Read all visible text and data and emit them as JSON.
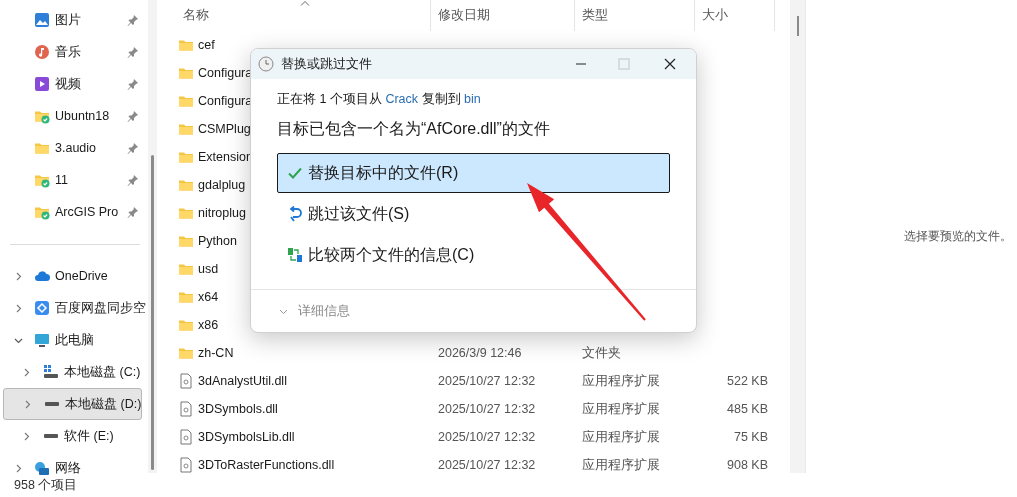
{
  "nav": {
    "quick_access": [
      {
        "label": "图片",
        "kind": "pictures",
        "pinned": true,
        "selected": false
      },
      {
        "label": "音乐",
        "kind": "music",
        "pinned": true,
        "selected": false
      },
      {
        "label": "视频",
        "kind": "videos",
        "pinned": true,
        "selected": false
      },
      {
        "label": "Ubuntn18",
        "kind": "synced-folder",
        "pinned": true,
        "selected": false
      },
      {
        "label": "3.audio",
        "kind": "folder",
        "pinned": true,
        "selected": false
      },
      {
        "label": "11",
        "kind": "synced-folder",
        "pinned": true,
        "selected": false
      },
      {
        "label": "ArcGIS Pro",
        "kind": "synced-folder",
        "pinned": true,
        "selected": false
      }
    ],
    "tree": [
      {
        "label": "OneDrive",
        "kind": "cloud",
        "expanded": false,
        "selected": false
      },
      {
        "label": "百度网盘同步空",
        "kind": "netdisk",
        "expanded": false,
        "selected": false
      },
      {
        "label": "此电脑",
        "kind": "computer",
        "expanded": true,
        "selected": false,
        "children": [
          {
            "label": "本地磁盘 (C:)",
            "kind": "system-drive",
            "expanded": false,
            "selected": false
          },
          {
            "label": "本地磁盘 (D:)",
            "kind": "drive",
            "expanded": false,
            "selected": true
          },
          {
            "label": "软件 (E:)",
            "kind": "drive",
            "expanded": false,
            "selected": false
          }
        ]
      },
      {
        "label": "网络",
        "kind": "network",
        "expanded": false,
        "selected": false
      }
    ]
  },
  "file_list": {
    "columns": [
      {
        "label": "名称",
        "sorted": true
      },
      {
        "label": "修改日期",
        "sorted": false
      },
      {
        "label": "类型",
        "sorted": false
      },
      {
        "label": "大小",
        "sorted": false
      }
    ],
    "rows": [
      {
        "kind": "folder",
        "name": "cef"
      },
      {
        "kind": "folder",
        "name": "Configura"
      },
      {
        "kind": "folder",
        "name": "Configura"
      },
      {
        "kind": "folder",
        "name": "CSMPlug"
      },
      {
        "kind": "folder",
        "name": "Extension"
      },
      {
        "kind": "folder",
        "name": "gdalplug"
      },
      {
        "kind": "folder",
        "name": "nitroplug"
      },
      {
        "kind": "folder",
        "name": "Python"
      },
      {
        "kind": "folder",
        "name": "usd"
      },
      {
        "kind": "folder",
        "name": "x64"
      },
      {
        "kind": "folder",
        "name": "x86"
      },
      {
        "kind": "folder",
        "name": "zh-CN",
        "date": "2026/3/9 12:46",
        "type": "文件夹"
      },
      {
        "kind": "file",
        "name": "3dAnalystUtil.dll",
        "date": "2025/10/27 12:32",
        "type": "应用程序扩展",
        "size": "522 KB"
      },
      {
        "kind": "file",
        "name": "3DSymbols.dll",
        "date": "2025/10/27 12:32",
        "type": "应用程序扩展",
        "size": "485 KB"
      },
      {
        "kind": "file",
        "name": "3DSymbolsLib.dll",
        "date": "2025/10/27 12:32",
        "type": "应用程序扩展",
        "size": "75 KB"
      },
      {
        "kind": "file",
        "name": "3DToRasterFunctions.dll",
        "date": "2025/10/27 12:32",
        "type": "应用程序扩展",
        "size": "908 KB"
      }
    ]
  },
  "preview": {
    "message": "选择要预览的文件。"
  },
  "status_bar": {
    "item_count": "958 个项目"
  },
  "dialog": {
    "title": "替换或跳过文件",
    "copy_status": {
      "prefix": "正在将 1 个项目从",
      "source": "Crack",
      "middle": "复制到",
      "destination": "bin"
    },
    "message": "目标已包含一个名为“AfCore.dll”的文件",
    "options": [
      {
        "kind": "replace",
        "label": "替换目标中的文件(R)",
        "selected": true
      },
      {
        "kind": "skip",
        "label": "跳过该文件(S)",
        "selected": false
      },
      {
        "kind": "compare",
        "label": "比较两个文件的信息(C)",
        "selected": false
      }
    ],
    "details": {
      "label": "详细信息",
      "expanded": false
    }
  }
}
